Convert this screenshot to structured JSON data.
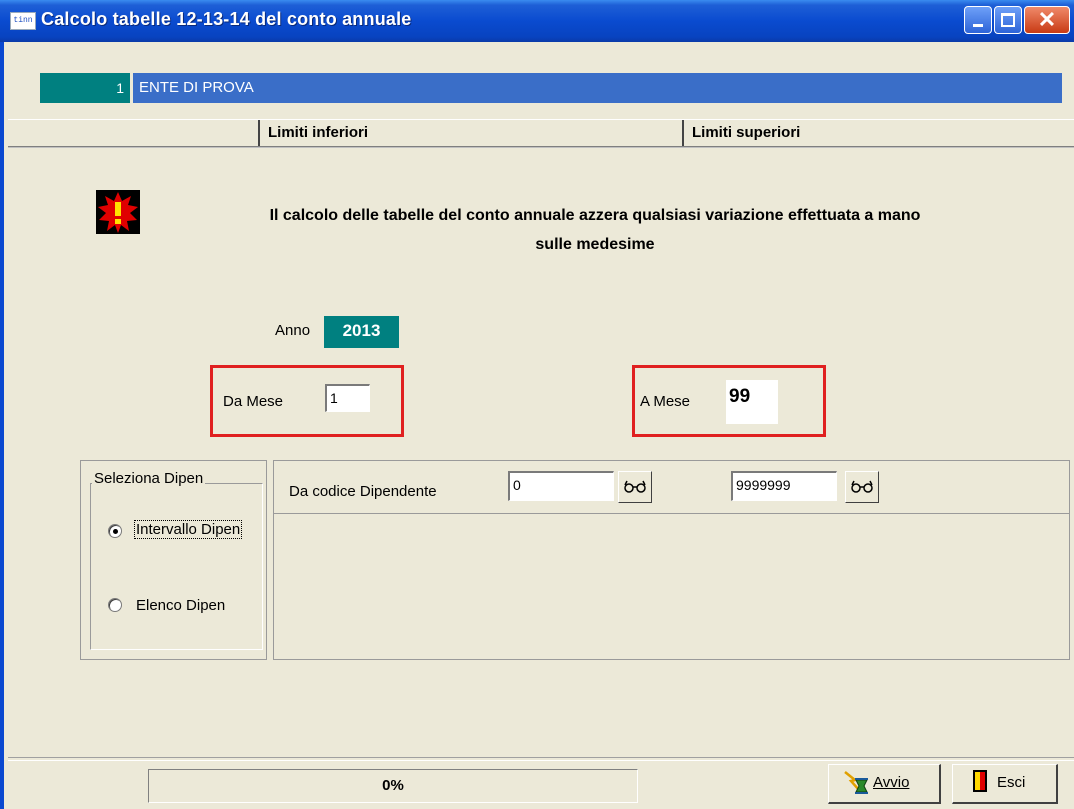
{
  "window": {
    "icon_text": "tinn",
    "title": "Calcolo tabelle 12-13-14 del conto annuale",
    "close_glyph": "✕"
  },
  "ente": {
    "code": "1",
    "name": "ENTE DI PROVA"
  },
  "header": {
    "col1": "Limiti inferiori",
    "col2": "Limiti superiori"
  },
  "warning": {
    "icon": "warning-burst-icon",
    "line1": "Il calcolo delle tabelle del conto annuale azzera qualsiasi variazione effettuata a mano",
    "line2": "sulle medesime"
  },
  "anno": {
    "label": "Anno",
    "value": "2013"
  },
  "mese": {
    "da_label": "Da Mese",
    "da_value": "1",
    "a_label": "A Mese",
    "a_value": "99"
  },
  "highlight_color": "#e02020",
  "seleziona": {
    "title": "Seleziona Dipen",
    "options": [
      {
        "label": "Intervallo Dipen",
        "selected": true
      },
      {
        "label": "Elenco Dipen",
        "selected": false
      }
    ]
  },
  "codice": {
    "label": "Da codice Dipendente",
    "from_value": "0",
    "to_value": "9999999",
    "lookup_icon": "binoculars-icon"
  },
  "progress": {
    "text": "0%",
    "value": 0
  },
  "buttons": {
    "avvio": "Avvio",
    "esci": "Esci"
  }
}
